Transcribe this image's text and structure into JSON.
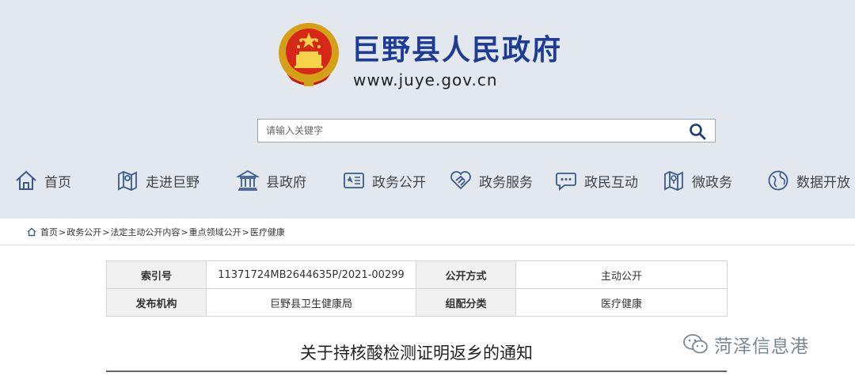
{
  "header": {
    "site_title": "巨野县人民政府",
    "site_url": "www.juye.gov.cn"
  },
  "search": {
    "placeholder": "请输入关键字"
  },
  "nav": [
    {
      "label": "首页",
      "icon": "home-icon"
    },
    {
      "label": "走进巨野",
      "icon": "map-icon"
    },
    {
      "label": "县政府",
      "icon": "government-building-icon"
    },
    {
      "label": "政务公开",
      "icon": "open-affairs-icon"
    },
    {
      "label": "政务服务",
      "icon": "handshake-icon"
    },
    {
      "label": "政民互动",
      "icon": "chat-icon"
    },
    {
      "label": "微政务",
      "icon": "mini-map-icon"
    },
    {
      "label": "数据开放",
      "icon": "globe-icon"
    }
  ],
  "breadcrumb": [
    "首页",
    "政务公开",
    "法定主动公开内容",
    "重点领域公开",
    "医疗健康"
  ],
  "meta": [
    {
      "k1": "索引号",
      "v1": "11371724MB2644635P/2021-00299",
      "k2": "公开方式",
      "v2": "主动公开"
    },
    {
      "k1": "发布机构",
      "v1": "巨野县卫生健康局",
      "k2": "组配分类",
      "v2": "医疗健康"
    }
  ],
  "article": {
    "title": "关于持核酸检测证明返乡的通知"
  },
  "watermark": {
    "text": "菏泽信息港"
  },
  "colors": {
    "header_bg": "#e3e8ef",
    "title_blue": "#1e3c94"
  }
}
